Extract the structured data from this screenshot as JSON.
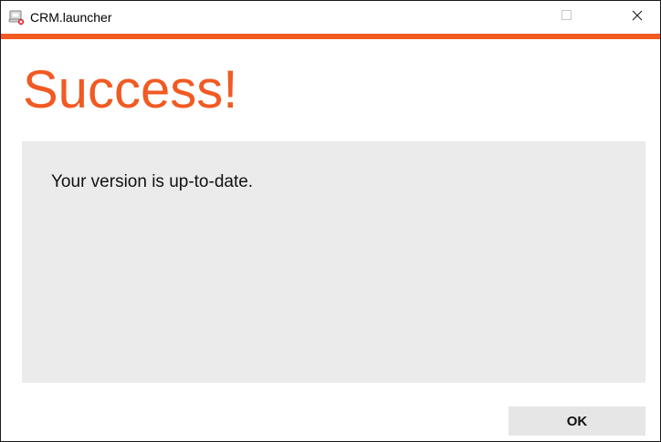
{
  "window": {
    "title": "CRM.launcher",
    "app_icon": "launcher-app-icon",
    "controls": {
      "minimize_icon": "minimize-icon",
      "maximize_icon": "maximize-icon",
      "close_icon": "close-icon"
    }
  },
  "colors": {
    "accent": "#f15a22",
    "panel_background": "#ebebeb",
    "button_background": "#e6e6e6"
  },
  "dialog": {
    "heading": "Success!",
    "message": "Your version is up-to-date.",
    "ok_label": "OK"
  }
}
